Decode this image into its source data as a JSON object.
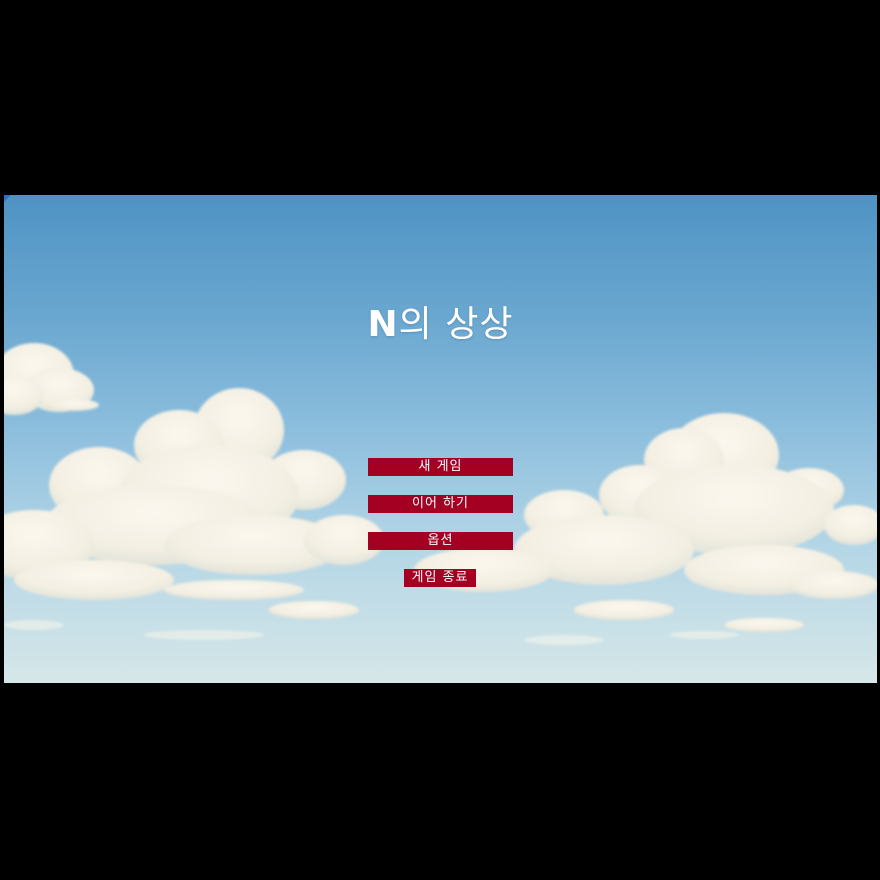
{
  "game": {
    "title_prefix": "N",
    "title_suffix": "의 상상"
  },
  "menu": {
    "new_game": "새 게임",
    "continue": "이어 하기",
    "options": "옵션",
    "quit": "게임 종료"
  },
  "colors": {
    "button_bg": "#a30022",
    "button_text": "#ffffff",
    "letterbox": "#000000",
    "sky_top": "#4e93c4",
    "sky_bottom": "#d6e7e8"
  }
}
